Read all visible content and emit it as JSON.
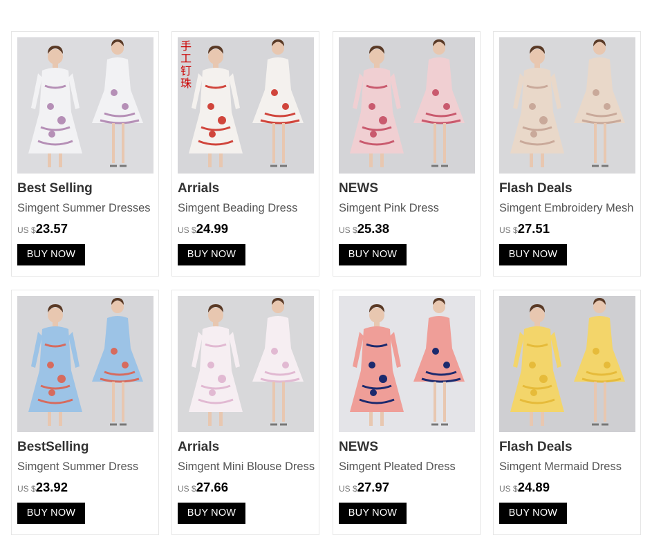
{
  "products": [
    {
      "tag": "Best Selling",
      "name": "Simgent Summer Dresses",
      "currency": "US $",
      "price": "23.57",
      "button": "BUY NOW",
      "image": "two-models-white-lace-dress",
      "bg": "#dcdcdf",
      "colors": [
        "#f2f2f4",
        "#b58fb6"
      ]
    },
    {
      "tag": "Arrials",
      "name": "Simgent Beading Dress",
      "currency": "US $",
      "price": "24.99",
      "button": "BUY NOW",
      "image": "two-models-white-floral-dress",
      "bg": "#d6d6d9",
      "colors": [
        "#f4f1ee",
        "#d0453c"
      ],
      "overlay_text": "手工钉珠"
    },
    {
      "tag": "NEWS",
      "name": "Simgent Pink Dress",
      "currency": "US $",
      "price": "25.38",
      "button": "BUY NOW",
      "image": "two-models-pink-floral-dress",
      "bg": "#d4d4d7",
      "colors": [
        "#f0cfd2",
        "#c95a6e"
      ]
    },
    {
      "tag": "Flash Deals",
      "name": "Simgent Embroidery Mesh",
      "currency": "US $",
      "price": "27.51",
      "button": "BUY NOW",
      "image": "two-models-beige-mesh-dress",
      "bg": "#d8d8da",
      "colors": [
        "#e9d8c9",
        "#c9a99a"
      ]
    },
    {
      "tag": "BestSelling",
      "name": "Simgent Summer Dress",
      "currency": "US $",
      "price": "23.92",
      "button": "BUY NOW",
      "image": "two-models-blue-striped-dress",
      "bg": "#d6d6d9",
      "colors": [
        "#9cc3e6",
        "#d66b5e"
      ]
    },
    {
      "tag": "Arrials",
      "name": "Simgent Mini Blouse Dress",
      "currency": "US $",
      "price": "27.66",
      "button": "BUY NOW",
      "image": "two-models-white-pink-mini-dress",
      "bg": "#d8d8da",
      "colors": [
        "#f6eef2",
        "#e1b9d2"
      ]
    },
    {
      "tag": "NEWS",
      "name": "Simgent Pleated Dress",
      "currency": "US $",
      "price": "27.97",
      "button": "BUY NOW",
      "image": "two-models-pink-navy-pleated-dress",
      "bg": "#e4e4e8",
      "colors": [
        "#ef9e98",
        "#1c2a6e"
      ]
    },
    {
      "tag": "Flash Deals",
      "name": "Simgent Mermaid Dress",
      "currency": "US $",
      "price": "24.89",
      "button": "BUY NOW",
      "image": "two-models-yellow-lace-dress",
      "bg": "#cfcfd2",
      "colors": [
        "#f3d56a",
        "#e6bb3a"
      ]
    }
  ]
}
